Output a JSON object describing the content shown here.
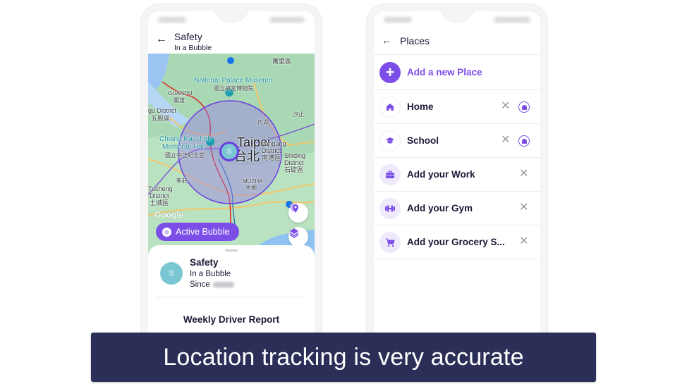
{
  "colors": {
    "accent": "#7b4ee8",
    "avatar": "#7ac7d3",
    "caption_bg": "#2b2f57",
    "text_dark": "#1f1535"
  },
  "left_phone": {
    "header": {
      "back_icon": "arrow-left-icon",
      "title": "Safety",
      "subtitle": "In a Bubble"
    },
    "map": {
      "labels": {
        "national_palace": "National Palace Museum",
        "national_palace_zh": "國立故宮博物院",
        "shuanglian": "萬里區",
        "guandu": "GUANDU",
        "guandu_zh": "關渡",
        "wugu": "gu District",
        "wugu_zh": "五股區",
        "cks_line1": "Chiang Kai-shek",
        "cks_line2": "Memorial Hall",
        "cks_zh": "國立中正紀念堂",
        "taipei": "Taipei",
        "taipei_zh": "台北",
        "nangang_line1": "Nangang",
        "nangang_line2": "District",
        "nangang_zh": "南港區",
        "shiding_line1": "Shiding",
        "shiding_line2": "District",
        "shiding_zh": "石碇區",
        "tucheng_line1": "Tucheng",
        "tucheng_line2": "District",
        "tucheng_zh": "土城區",
        "muzha": "MUZHA",
        "muzha_zh": "木柵",
        "neihu": "內湖",
        "xizhi": "汐止",
        "xinzhuang": "新莊"
      },
      "google_logo": "Google",
      "user_marker_initial": "S",
      "active_bubble_label": "Active Bubble",
      "fab_places_icon": "map-pins-icon",
      "fab_layers_icon": "layers-icon"
    },
    "sheet": {
      "avatar_initial": "S",
      "name": "Safety",
      "status": "In a Bubble",
      "since_label": "Since",
      "report_title": "Weekly Driver Report"
    }
  },
  "right_phone": {
    "header": {
      "back_icon": "arrow-left-icon",
      "title": "Places"
    },
    "add_place": {
      "icon": "plus-icon",
      "label": "Add a new Place"
    },
    "places": [
      {
        "icon": "home-icon",
        "label": "Home",
        "has_remove": true,
        "has_alert": true,
        "filled": false
      },
      {
        "icon": "graduation-cap-icon",
        "label": "School",
        "has_remove": true,
        "has_alert": true,
        "filled": false
      },
      {
        "icon": "briefcase-icon",
        "label": "Add your Work",
        "has_remove": true,
        "has_alert": false,
        "filled": true
      },
      {
        "icon": "dumbbell-icon",
        "label": "Add your Gym",
        "has_remove": true,
        "has_alert": false,
        "filled": true
      },
      {
        "icon": "cart-icon",
        "label": "Add your Grocery S...",
        "has_remove": true,
        "has_alert": false,
        "filled": true
      }
    ],
    "remove_glyph": "✕"
  },
  "caption": {
    "text": "Location tracking is very accurate"
  }
}
